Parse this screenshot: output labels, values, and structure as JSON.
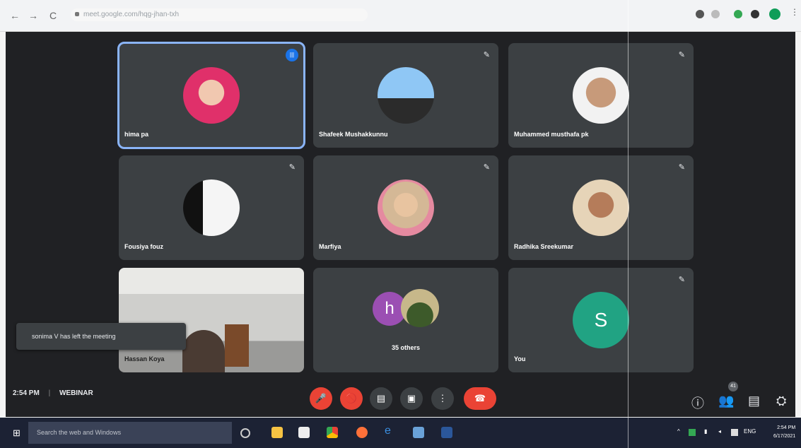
{
  "browser": {
    "url": "meet.google.com/hqg-jhan-txh",
    "nav": {
      "back": "←",
      "forward": "→",
      "reload": "C"
    }
  },
  "tiles": [
    {
      "name": "hima pa",
      "active": true
    },
    {
      "name": "Shafeek Mushakkunnu"
    },
    {
      "name": "Muhammed musthafa pk"
    },
    {
      "name": "Fousiya fouz"
    },
    {
      "name": "Marfiya"
    },
    {
      "name": "Radhika Sreekumar"
    },
    {
      "name": "Hassan Koya"
    },
    {
      "name": "35 others",
      "initial": "h"
    },
    {
      "name": "You",
      "initial": "S"
    }
  ],
  "toast": "sonima V has left the meeting",
  "meeting": {
    "time": "2:54 PM",
    "separator": "|",
    "title": "WEBINAR"
  },
  "participants_badge": "41",
  "controls": {
    "mic": "🎤",
    "cam": "🚫",
    "cc": "▤",
    "present": "▣",
    "more": "⋮",
    "hangup": "☎"
  },
  "right_controls": {
    "info": "ⓘ",
    "people": "👥",
    "chat": "▤",
    "activities": "⛭"
  },
  "taskbar": {
    "search_placeholder": "Search the web and Windows",
    "lang": "ENG",
    "time": "2:54 PM",
    "date": "6/17/2021",
    "start_icon": "⊞"
  }
}
